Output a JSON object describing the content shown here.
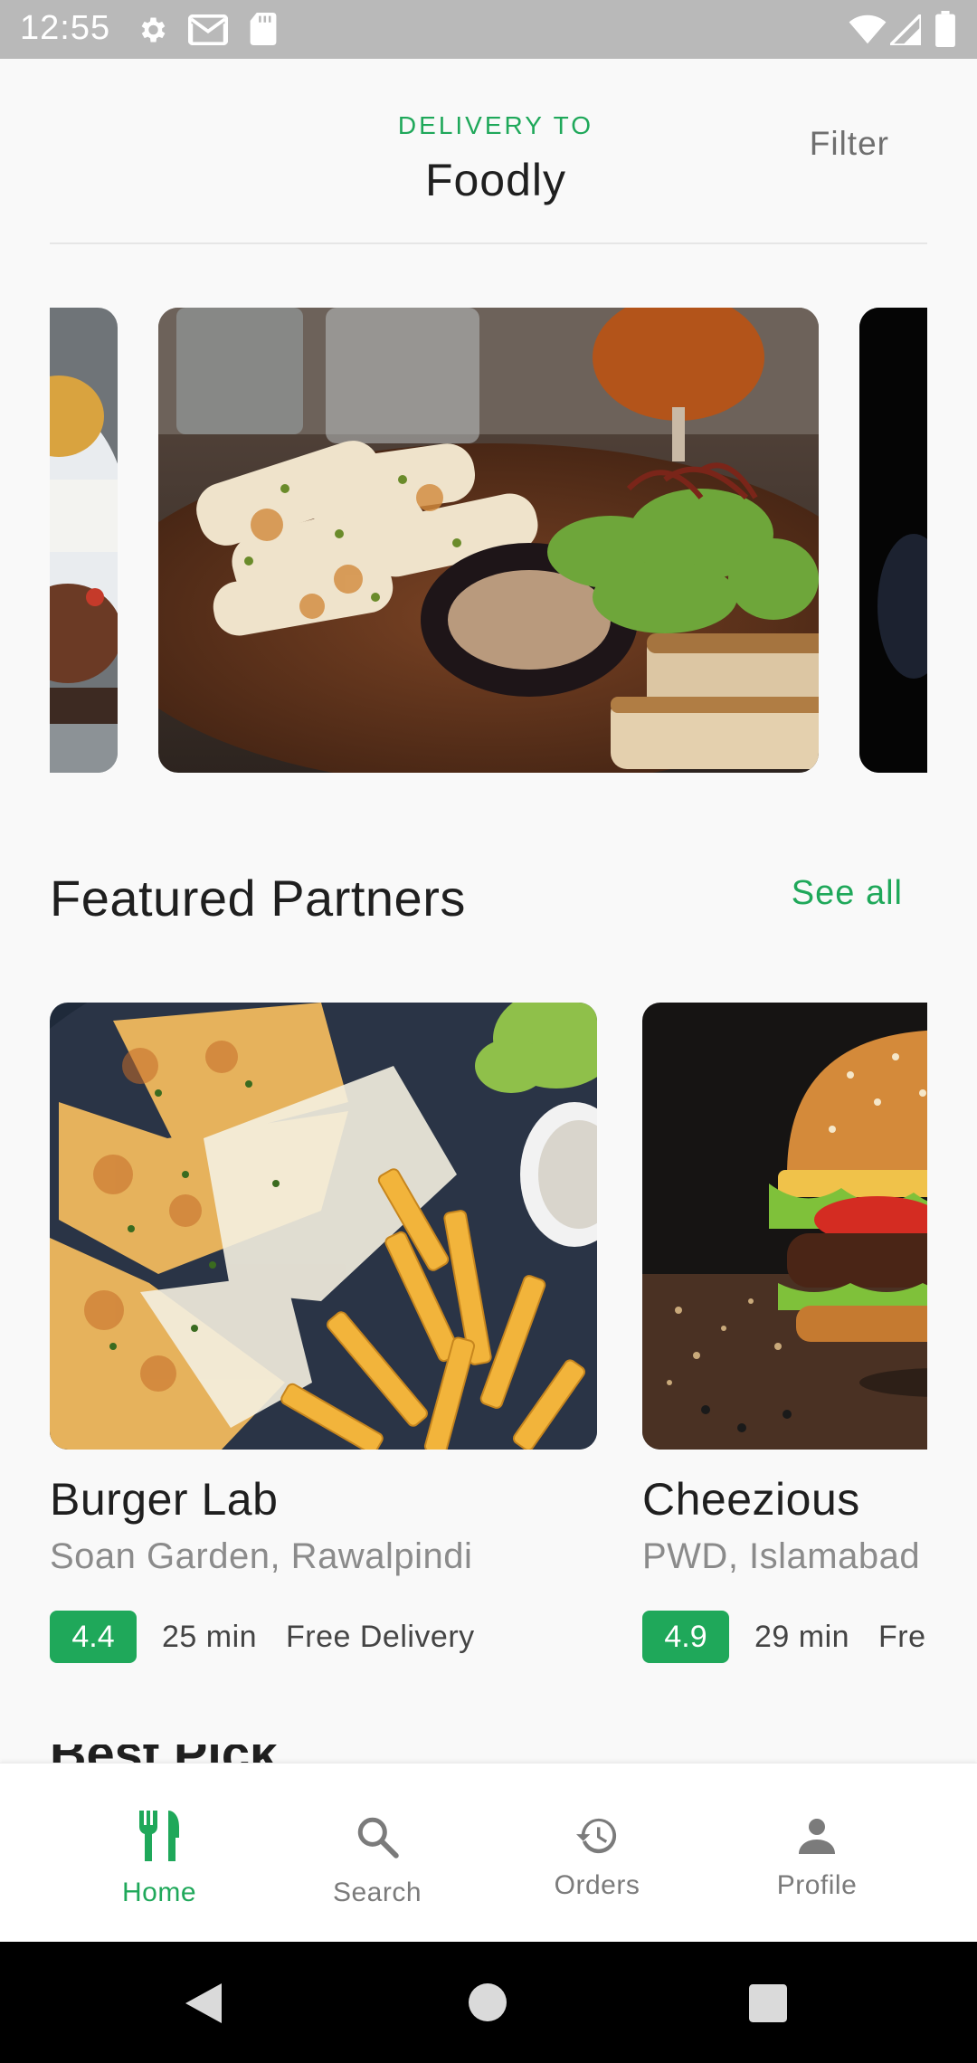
{
  "status_bar": {
    "time": "12:55",
    "left_icons": [
      "gear-icon",
      "gmail-icon",
      "sd-card-icon"
    ],
    "right_icons": [
      "wifi-icon",
      "signal-icon",
      "battery-icon"
    ]
  },
  "header": {
    "delivery_label": "DELIVERY TO",
    "location": "Foodly",
    "filter_label": "Filter"
  },
  "carousel": {
    "items": [
      "grilled-steak-plate",
      "grilled-calamari-salad-plate",
      "dark-food-photo"
    ]
  },
  "featured": {
    "title": "Featured Partners",
    "see_all": "See all",
    "partners": [
      {
        "name": "Burger Lab",
        "address": "Soan Garden, Rawalpindi",
        "rating": "4.4",
        "time": "25 min",
        "fee": "Free Delivery",
        "image": "cheese-quesadilla-fries"
      },
      {
        "name": "Cheezious",
        "address": "PWD, Islamabad",
        "rating": "4.9",
        "time": "29 min",
        "fee": "Free Delivery",
        "image": "burger"
      }
    ]
  },
  "next_section_title": "Best Pick",
  "bottom_nav": {
    "items": [
      {
        "label": "Home",
        "icon": "fork-knife-icon",
        "active": true
      },
      {
        "label": "Search",
        "icon": "search-icon",
        "active": false
      },
      {
        "label": "Orders",
        "icon": "history-icon",
        "active": false
      },
      {
        "label": "Profile",
        "icon": "person-icon",
        "active": false
      }
    ]
  },
  "colors": {
    "accent": "#1fa85a",
    "background": "#f9f9f9",
    "text": "#1f1f1f",
    "muted": "#8b8b8b"
  }
}
